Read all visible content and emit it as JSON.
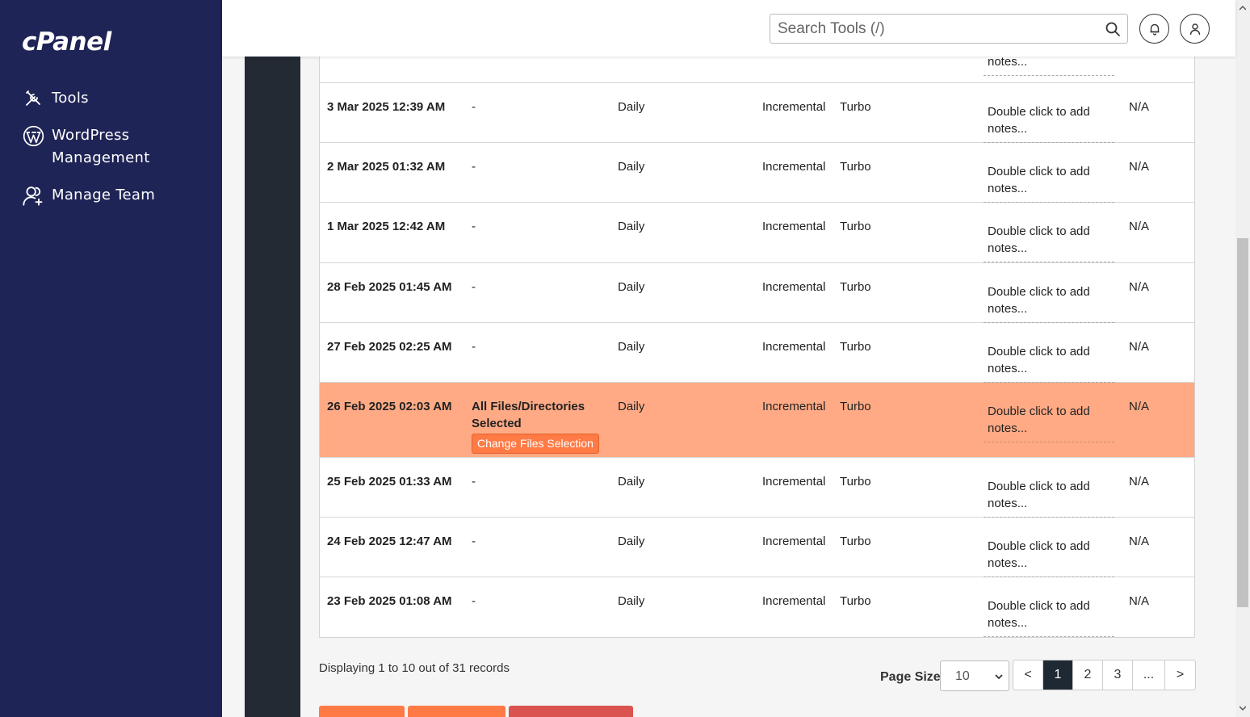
{
  "app": {
    "logo": "cPanel",
    "nav": [
      {
        "label": "Tools",
        "icon": "tools-icon"
      },
      {
        "label": "WordPress Management",
        "icon": "wordpress-icon"
      },
      {
        "label": "Manage Team",
        "icon": "manage-team-icon"
      }
    ]
  },
  "header": {
    "search_placeholder": "Search Tools (/)"
  },
  "table": {
    "top_partial_note": "notes...",
    "rows": [
      {
        "date": "3 Mar 2025 12:39 AM",
        "files": "-",
        "frequency": "Daily",
        "type": "Incremental",
        "mode": "Turbo",
        "notes": "Double click to add notes...",
        "extra": "N/A"
      },
      {
        "date": "2 Mar 2025 01:32 AM",
        "files": "-",
        "frequency": "Daily",
        "type": "Incremental",
        "mode": "Turbo",
        "notes": "Double click to add notes...",
        "extra": "N/A"
      },
      {
        "date": "1 Mar 2025 12:42 AM",
        "files": "-",
        "frequency": "Daily",
        "type": "Incremental",
        "mode": "Turbo",
        "notes": "Double click to add notes...",
        "extra": "N/A"
      },
      {
        "date": "28 Feb 2025 01:45 AM",
        "files": "-",
        "frequency": "Daily",
        "type": "Incremental",
        "mode": "Turbo",
        "notes": "Double click to add notes...",
        "extra": "N/A"
      },
      {
        "date": "27 Feb 2025 02:25 AM",
        "files": "-",
        "frequency": "Daily",
        "type": "Incremental",
        "mode": "Turbo",
        "notes": "Double click to add notes...",
        "extra": "N/A"
      },
      {
        "date": "26 Feb 2025 02:03 AM",
        "files": "All Files/Directories Selected",
        "frequency": "Daily",
        "type": "Incremental",
        "mode": "Turbo",
        "notes": "Double click to add notes...",
        "extra": "N/A",
        "selected": true,
        "change_button": "Change Files Selection"
      },
      {
        "date": "25 Feb 2025 01:33 AM",
        "files": "-",
        "frequency": "Daily",
        "type": "Incremental",
        "mode": "Turbo",
        "notes": "Double click to add notes...",
        "extra": "N/A"
      },
      {
        "date": "24 Feb 2025 12:47 AM",
        "files": "-",
        "frequency": "Daily",
        "type": "Incremental",
        "mode": "Turbo",
        "notes": "Double click to add notes...",
        "extra": "N/A"
      },
      {
        "date": "23 Feb 2025 01:08 AM",
        "files": "-",
        "frequency": "Daily",
        "type": "Incremental",
        "mode": "Turbo",
        "notes": "Double click to add notes...",
        "extra": "N/A"
      }
    ]
  },
  "footer": {
    "displaying": "Displaying 1 to 10 out of 31 records",
    "page_size_label": "Page Size",
    "page_size_value": "10",
    "pages": [
      "<",
      "1",
      "2",
      "3",
      "...",
      ">"
    ],
    "active_page": "1"
  },
  "colors": {
    "sidebar": "#1f2456",
    "highlight_row": "#ffaa85",
    "accent_orange": "#ff7a45",
    "danger_red": "#d9534f",
    "active_page": "#1f2933"
  }
}
